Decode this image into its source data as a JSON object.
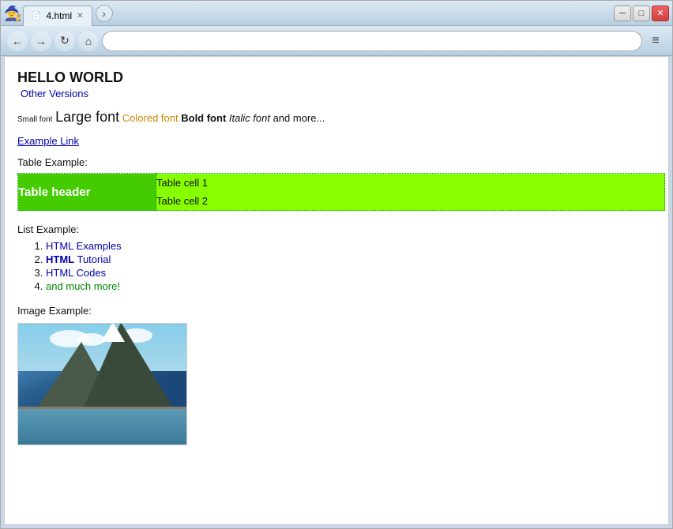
{
  "window": {
    "title": "4.html",
    "tab_label": "4.html"
  },
  "nav": {
    "address": "",
    "address_placeholder": ""
  },
  "page": {
    "heading": "HELLO WORLD",
    "other_versions": "Other Versions",
    "font_small": "Small font",
    "font_large": "Large font",
    "font_colored": "Colored font",
    "font_bold": "Bold font",
    "font_italic": "Italic font",
    "font_more": "and more...",
    "example_link": "Example Link",
    "table_label": "Table Example:",
    "table_header": "Table header",
    "table_cell1": "Table cell 1",
    "table_cell2": "Table cell 2",
    "list_label": "List Example:",
    "list_items": [
      {
        "text": "HTML Examples",
        "num": "1."
      },
      {
        "text": "HTML Tutorial",
        "num": "2."
      },
      {
        "text": "HTML Codes",
        "num": "3."
      },
      {
        "text": "and much more!",
        "num": "4."
      }
    ],
    "image_label": "Image Example:"
  },
  "controls": {
    "minimize": "─",
    "maximize": "□",
    "close": "✕",
    "back": "←",
    "forward": "→",
    "reload": "↻",
    "home": "⌂",
    "menu": "≡"
  }
}
